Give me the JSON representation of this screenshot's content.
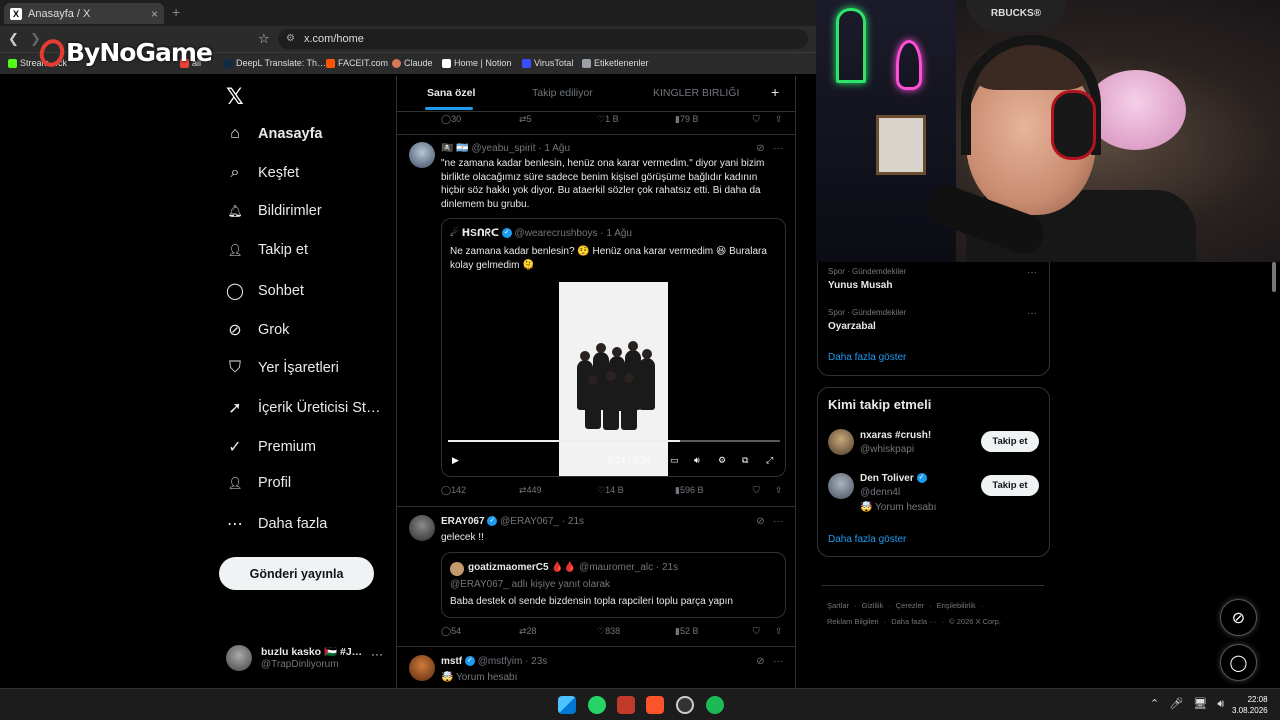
{
  "browser": {
    "tab_title": "Anasayfa / X",
    "tab_close": "×",
    "new_tab": "+",
    "url": "x.com/home",
    "bookmarks": [
      {
        "label": "Stream…ck",
        "color": "#53fc18"
      },
      {
        "label": "ail",
        "color": "#ea4335"
      },
      {
        "label": "DeepL Translate: Th…",
        "color": "#0f2b46"
      },
      {
        "label": "FACEIT.com",
        "color": "#ff5500"
      },
      {
        "label": "Claude",
        "color": "#d97757"
      },
      {
        "label": "Home | Notion",
        "color": "#ffffff"
      },
      {
        "label": "VirusTotal",
        "color": "#394eff"
      },
      {
        "label": "Etiketlenenler",
        "color": "#9aa0a6"
      }
    ]
  },
  "watermark": "ByNoGame",
  "sidebar": {
    "logo": "𝕏",
    "items": [
      {
        "label": "Anasayfa",
        "icon": "home-icon",
        "glyph": "⌂"
      },
      {
        "label": "Keşfet",
        "icon": "search-icon",
        "glyph": "⌕"
      },
      {
        "label": "Bildirimler",
        "icon": "bell-icon",
        "glyph": "🔔︎"
      },
      {
        "label": "Takip et",
        "icon": "follow-icon",
        "glyph": "👤︎"
      },
      {
        "label": "Sohbet",
        "icon": "chat-icon",
        "glyph": "◯"
      },
      {
        "label": "Grok",
        "icon": "grok-icon",
        "glyph": "⊘"
      },
      {
        "label": "Yer İşaretleri",
        "icon": "bookmark-icon",
        "glyph": "⛉"
      },
      {
        "label": "İçerik Üreticisi St…",
        "icon": "rocket-icon",
        "glyph": "➚"
      },
      {
        "label": "Premium",
        "icon": "premium-icon",
        "glyph": "✓"
      },
      {
        "label": "Profil",
        "icon": "profile-icon",
        "glyph": "👤︎"
      },
      {
        "label": "Daha fazla",
        "icon": "more-icon",
        "glyph": "⋯"
      }
    ],
    "post_button": "Gönderi yayınla",
    "account": {
      "name": "buzlu kasko 🇵🇸 #J…",
      "handle": "@TrapDinliyorum",
      "more": "···"
    }
  },
  "feed": {
    "tabs": [
      "Sana özel",
      "Takip ediliyor",
      "KINGLER BIRLIĞI"
    ],
    "plus": "+",
    "top_actions": {
      "replies": "30",
      "reposts": "5",
      "likes": "1 B",
      "views": "79 B"
    },
    "post1": {
      "flags": "🏴‍☠️ 🇦🇷",
      "handle": "@yeabu_spirit",
      "time": "· 1 Ağu",
      "text": "\"ne zamana kadar benlesin, henüz ona karar vermedim.\" diyor yani bizim birlikte olacağımız süre sadece benim kişisel görüşüme bağlıdır kadının hiçbir söz hakkı yok diyor. Bu ataerkil sözler çok rahatsız etti. Bi daha da dinlemem bu grubu.",
      "quote": {
        "name": "☄ ᕼSᑎᖇᑕ",
        "handle": "@wearecrushboys",
        "time": "· 1 Ağu",
        "text": "Ne zamana kadar benlesin? 🤨 Henüz ona karar vermedim 😆 Buralara kolay gelmedim 🫠"
      },
      "video": {
        "time": "0:24 / 0:34",
        "progress": 0.7
      },
      "actions": {
        "replies": "142",
        "reposts": "449",
        "likes": "14 B",
        "views": "596 B"
      }
    },
    "post2": {
      "name": "ERAY067",
      "handle": "@ERAY067_",
      "time": "· 21s",
      "text": "gelecek !!",
      "quote": {
        "name": "goatizmaomerC5 🩸🩸",
        "handle": "@mauromer_alc",
        "time": "· 21s",
        "reply_to": "@ERAY067_ adlı kişiye yanıt olarak",
        "text": "Baba destek ol sende bizdensin topla rapcileri toplu parça yapın"
      },
      "actions": {
        "replies": "54",
        "reposts": "28",
        "likes": "838",
        "views": "52 B"
      }
    },
    "post3": {
      "name": "mstf",
      "handle": "@mstfyim",
      "time": "· 23s",
      "sub": "🤯 Yorum hesabı"
    }
  },
  "trends": [
    {
      "category": "Spor · Gündemdekiler",
      "name": "Yunus Musah"
    },
    {
      "category": "Spor · Gündemdekiler",
      "name": "Oyarzabal"
    }
  ],
  "trends_show_more": "Daha fazla göster",
  "who_to_follow": {
    "title": "Kimi takip etmeli",
    "users": [
      {
        "name": "nxaras #crush!",
        "handle": "@whiskpapi",
        "sub": "",
        "button": "Takip et",
        "verified": false
      },
      {
        "name": "Den Toliver",
        "handle": "@denn4l",
        "sub": "🤯 Yorum hesabı",
        "button": "Takip et",
        "verified": true
      }
    ],
    "show_more": "Daha fazla göster"
  },
  "footer": {
    "line1": [
      "Şartlar",
      "Gizlilik",
      "Çerezler",
      "Erişilebilirlik"
    ],
    "line2": [
      "Reklam Bilgileri",
      "Daha fazla ···",
      "© 2026 X Corp."
    ]
  },
  "webcam": {
    "sign": "RBUCKS®"
  },
  "taskbar": {
    "time": "22:08",
    "date": "3.08.2026",
    "tray": [
      "⌃",
      "🎤︎",
      "🖥︎",
      "🔊︎"
    ]
  },
  "colors": {
    "accent": "#1d9bf0",
    "background": "#000000",
    "border": "#2f3336",
    "muted": "#71767b"
  }
}
